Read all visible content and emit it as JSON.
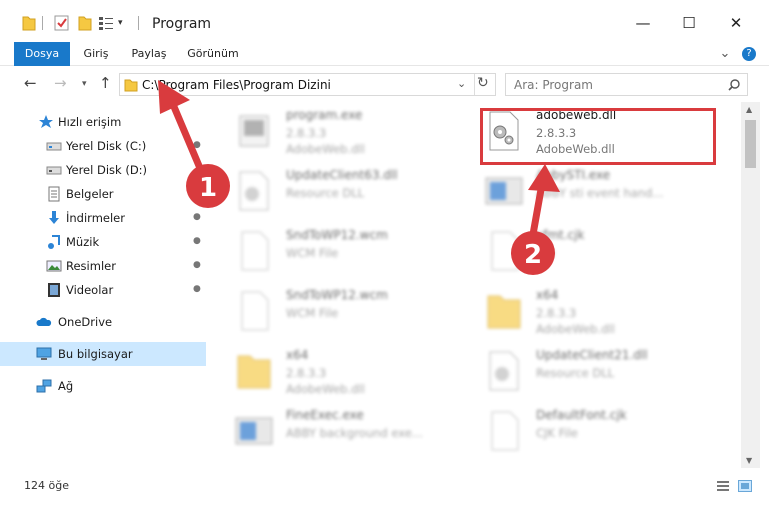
{
  "window": {
    "title": "Program",
    "minimize_glyph": "—",
    "maximize_glyph": "☐",
    "close_glyph": "✕"
  },
  "ribbon": {
    "tabs": [
      "Dosya",
      "Giriş",
      "Paylaş",
      "Görünüm"
    ],
    "expand_glyph": "⌄",
    "help_glyph": "?"
  },
  "address": {
    "path": "C:\\Program Files\\Program Dizini",
    "search_placeholder": "Ara: Program"
  },
  "sidebar": {
    "items": [
      {
        "label": "Hızlı erişim",
        "icon": "star-icon",
        "pinned": false
      },
      {
        "label": "Yerel Disk (C:)",
        "icon": "drive-icon",
        "pinned": true
      },
      {
        "label": "Yerel Disk (D:)",
        "icon": "drive-icon",
        "pinned": false
      },
      {
        "label": "Belgeler",
        "icon": "documents-icon",
        "pinned": true
      },
      {
        "label": "İndirmeler",
        "icon": "download-icon",
        "pinned": true
      },
      {
        "label": "Müzik",
        "icon": "music-icon",
        "pinned": true
      },
      {
        "label": "Resimler",
        "icon": "pictures-icon",
        "pinned": true
      },
      {
        "label": "Videolar",
        "icon": "videos-icon",
        "pinned": true
      },
      {
        "label": "OneDrive",
        "icon": "cloud-icon",
        "pinned": false
      },
      {
        "label": "Bu bilgisayar",
        "icon": "computer-icon",
        "pinned": false
      },
      {
        "label": "Ağ",
        "icon": "network-icon",
        "pinned": false
      }
    ],
    "pin_glyph": "📌"
  },
  "files": [
    {
      "name": "program.exe",
      "line1": "2.8.3.3",
      "line2": "AdobeWeb.dll",
      "icon": "exe-icon",
      "blurred": true
    },
    {
      "name": "adobeweb.dll",
      "line1": "2.8.3.3",
      "line2": "AdobeWeb.dll",
      "icon": "dll-gear-icon",
      "blurred": false
    },
    {
      "name": "UpdateClient63.dll",
      "line1": "Resource DLL",
      "line2": "",
      "icon": "dll-gear-icon",
      "blurred": true
    },
    {
      "name": "AbbySTI.exe",
      "line1": "ABBY sti event hand...",
      "line2": "",
      "icon": "exe-blue-icon",
      "blurred": true
    },
    {
      "name": "SndToWP12.wcm",
      "line1": "WCM File",
      "line2": "",
      "icon": "file-icon",
      "blurred": true
    },
    {
      "name": "xfmt.cjk",
      "line1": "File",
      "line2": "",
      "icon": "file-icon",
      "blurred": true
    },
    {
      "name": "SndToWP12.wcm",
      "line1": "WCM File",
      "line2": "",
      "icon": "file-icon",
      "blurred": true
    },
    {
      "name": "x64",
      "line1": "2.8.3.3",
      "line2": "AdobeWeb.dll",
      "icon": "folder-icon",
      "blurred": true
    },
    {
      "name": "x64",
      "line1": "2.8.3.3",
      "line2": "AdobeWeb.dll",
      "icon": "folder-icon",
      "blurred": true
    },
    {
      "name": "UpdateClient21.dll",
      "line1": "Resource DLL",
      "line2": "",
      "icon": "dll-gear-icon",
      "blurred": true
    },
    {
      "name": "FineExec.exe",
      "line1": "ABBY background exe...",
      "line2": "",
      "icon": "exe-blue-icon",
      "blurred": true
    },
    {
      "name": "DefaultFont.cjk",
      "line1": "CJK File",
      "line2": "",
      "icon": "file-icon",
      "blurred": true
    }
  ],
  "status": {
    "item_count": "124 öğe"
  },
  "annotations": [
    {
      "number": "1"
    },
    {
      "number": "2"
    }
  ],
  "colors": {
    "accent": "#1979ca",
    "selection": "#cce8ff",
    "annotation_red": "#d93b3e"
  }
}
